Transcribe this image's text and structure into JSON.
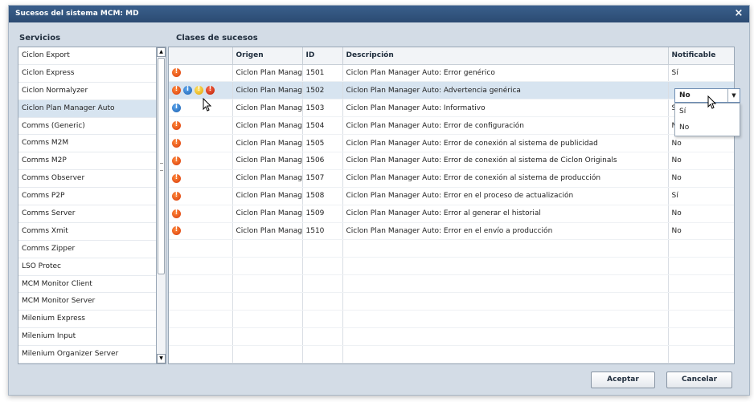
{
  "window": {
    "title": "Sucesos del sistema MCM: MD",
    "close_label": "×"
  },
  "services": {
    "label": "Servicios",
    "items": [
      "Ciclon Export",
      "Ciclon Express",
      "Ciclon Normalyzer",
      "Ciclon Plan Manager Auto",
      "Comms (Generic)",
      "Comms M2M",
      "Comms M2P",
      "Comms Observer",
      "Comms P2P",
      "Comms Server",
      "Comms Xmit",
      "Comms Zipper",
      "LSO Protec",
      "MCM Monitor Client",
      "MCM Monitor Server",
      "Milenium Express",
      "Milenium Input",
      "Milenium Organizer Server"
    ],
    "selected": "Ciclon Plan Manager Auto"
  },
  "events": {
    "label": "Clases de sucesos",
    "columns": [
      "",
      "Origen",
      "ID",
      "Descripción",
      "Notificable"
    ],
    "rows": [
      {
        "icon": "error",
        "origin": "Ciclon Plan Manag",
        "id": "1501",
        "description": "Ciclon Plan Manager Auto: Error genérico",
        "notify": "Sí"
      },
      {
        "icon": "error-info-warning-critical",
        "origin": "Ciclon Plan Manag",
        "id": "1502",
        "description": "Ciclon Plan Manager Auto: Advertencia genérica",
        "notify": "No"
      },
      {
        "icon": "info",
        "origin": "Ciclon Plan Manag",
        "id": "1503",
        "description": "Ciclon Plan Manager Auto: Informativo",
        "notify": "Sí"
      },
      {
        "icon": "error",
        "origin": "Ciclon Plan Manag",
        "id": "1504",
        "description": "Ciclon Plan Manager Auto: Error de configuración",
        "notify": "No"
      },
      {
        "icon": "error",
        "origin": "Ciclon Plan Manag",
        "id": "1505",
        "description": "Ciclon Plan Manager Auto: Error de conexión al sistema de publicidad",
        "notify": "No"
      },
      {
        "icon": "error",
        "origin": "Ciclon Plan Manag",
        "id": "1506",
        "description": "Ciclon Plan Manager Auto: Error de conexión al sistema de Ciclon Originals",
        "notify": "No"
      },
      {
        "icon": "error",
        "origin": "Ciclon Plan Manag",
        "id": "1507",
        "description": "Ciclon Plan Manager Auto: Error de conexión al sistema de producción",
        "notify": "No"
      },
      {
        "icon": "error",
        "origin": "Ciclon Plan Manag",
        "id": "1508",
        "description": "Ciclon Plan Manager Auto: Error en el proceso de actualización",
        "notify": "Sí"
      },
      {
        "icon": "error",
        "origin": "Ciclon Plan Manag",
        "id": "1509",
        "description": "Ciclon Plan Manager Auto: Error al generar el historial",
        "notify": "No"
      },
      {
        "icon": "error",
        "origin": "Ciclon Plan Manag",
        "id": "1510",
        "description": "Ciclon Plan Manager Auto: Error en el envío a producción",
        "notify": "No"
      }
    ],
    "selected_row": 1,
    "empty_rows": 8
  },
  "notify_dropdown": {
    "value": "No",
    "options": [
      "Sí",
      "No"
    ]
  },
  "buttons": {
    "accept": "Aceptar",
    "cancel": "Cancelar"
  },
  "colors": {
    "titlebar": "#2f5581",
    "selection": "#d7e4f0",
    "dialog_bg": "#d3dce6"
  }
}
